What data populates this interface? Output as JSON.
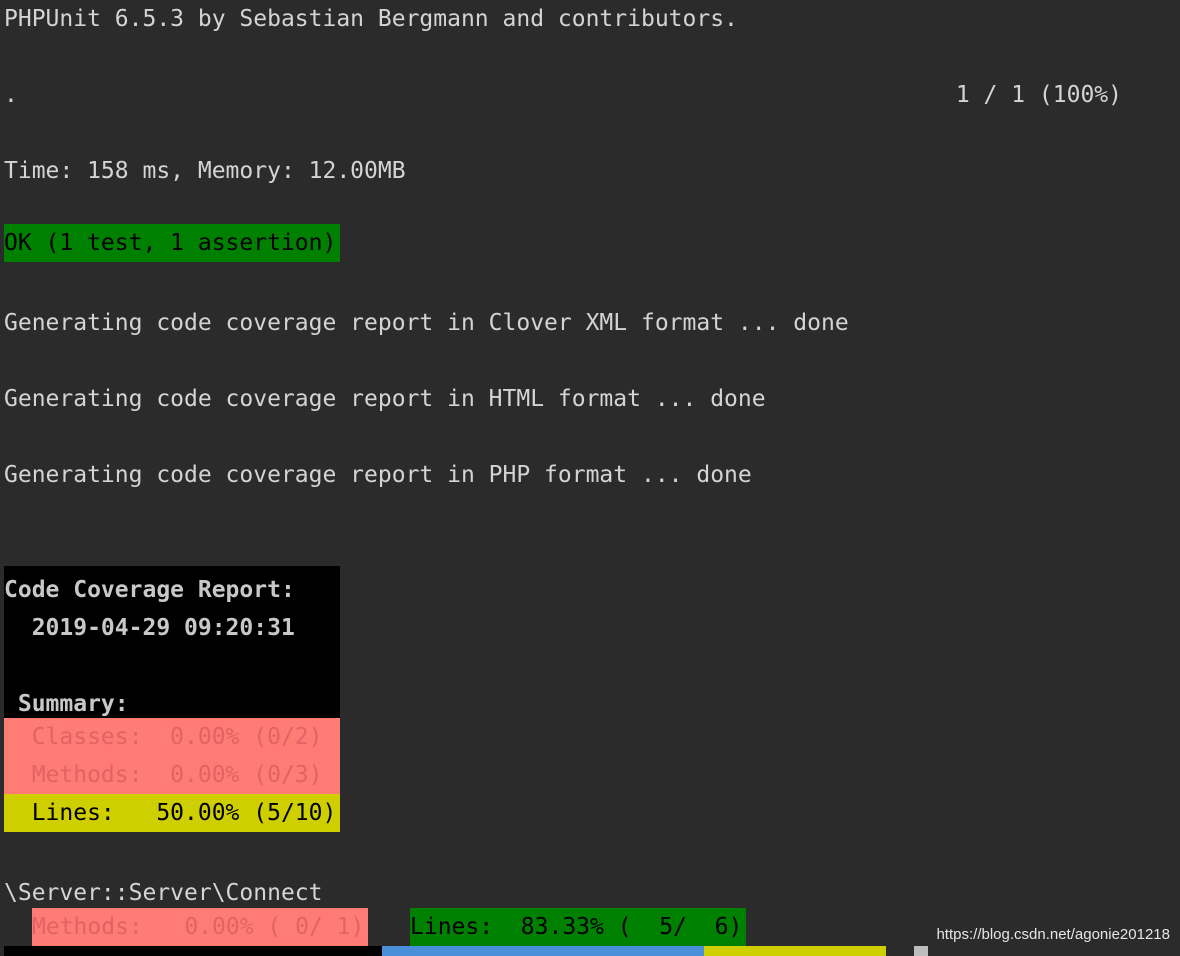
{
  "terminal": {
    "header": "PHPUnit 6.5.3 by Sebastian Bergmann and contributors.",
    "progress_dot": ".",
    "progress_count": "1 / 1 (100%)",
    "timing": "Time: 158 ms, Memory: 12.00MB",
    "result": "OK (1 test, 1 assertion)",
    "clover": "Generating code coverage report in Clover XML format ... done",
    "html": "Generating code coverage report in HTML format ... done",
    "php": "Generating code coverage report in PHP format ... done"
  },
  "report": {
    "title": "Code Coverage Report:",
    "timestamp": "  2019-04-29 09:20:31",
    "summary_label": " Summary:",
    "classes": "  Classes:  0.00% (0/2)",
    "methods": "  Methods:  0.00% (0/3)",
    "lines": "  Lines:   50.00% (5/10)"
  },
  "class_section": {
    "name": "\\Server::Server\\Connect",
    "methods": "Methods:   0.00% ( 0/ 1)",
    "lines": "Lines:  83.33% (  5/  6)"
  },
  "watermark": "https://blog.csdn.net/agonie201218",
  "colors": {
    "background": "#2b2b2b",
    "ok_green": "#008000",
    "bad_red": "#ff7b76",
    "warn_yellow": "#cfcf00",
    "report_black": "#000000"
  }
}
